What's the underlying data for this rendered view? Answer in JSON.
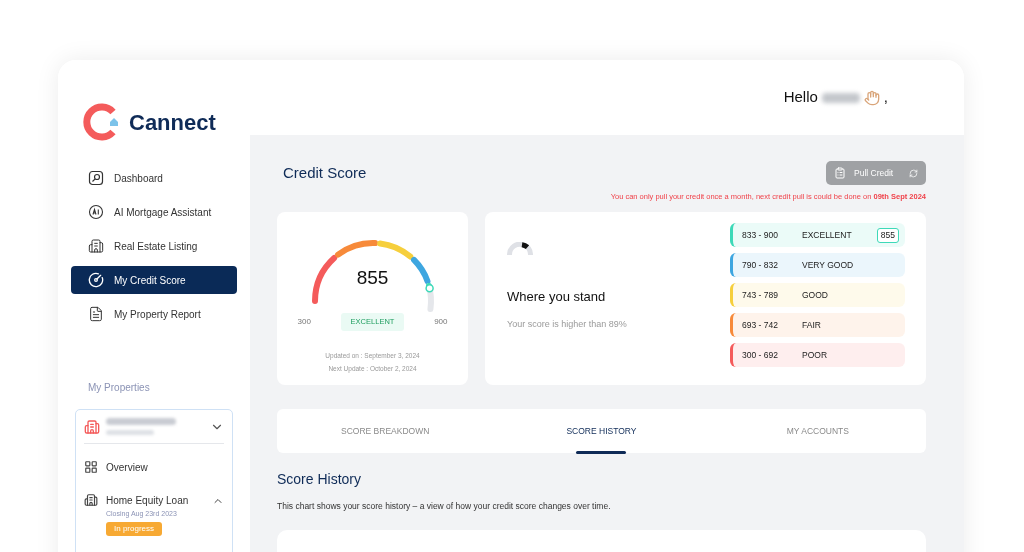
{
  "brand": {
    "name": "Cannect"
  },
  "sidebar": {
    "items": [
      {
        "label": "Dashboard",
        "selected": false
      },
      {
        "label": "AI Mortgage Assistant",
        "selected": false
      },
      {
        "label": "Real Estate Listing",
        "selected": false
      },
      {
        "label": "My Credit Score",
        "selected": true
      },
      {
        "label": "My Property Report",
        "selected": false
      }
    ],
    "section_title": "My Properties",
    "property": {
      "expanded": true,
      "items": [
        {
          "label": "Overview"
        },
        {
          "label": "Home Equity Loan",
          "expanded": true,
          "subtitle": "Closing Aug 23rd 2023",
          "status": "In progress"
        }
      ]
    }
  },
  "header": {
    "greeting": "Hello",
    "suffix": ","
  },
  "page": {
    "title": "Credit Score",
    "pull_button": {
      "label": "Pull Credit",
      "disabled": true
    },
    "notice": "You can only pull your credit once a month, next credit pull is could be done on **09th Sept 2024**"
  },
  "gauge": {
    "score": "855",
    "level": 0.93,
    "min": "300",
    "max": "900",
    "rating": "EXCELLENT",
    "updated": "Updated on : September 3, 2024",
    "next_update": "Next Update : October 2, 2024"
  },
  "standing": {
    "title": "Where you stand",
    "subtitle": "Your score is higher than 89%"
  },
  "ranges": [
    {
      "range": "833 - 900",
      "label": "EXCELLENT",
      "color": "#3dd9b8",
      "badge": "855"
    },
    {
      "range": "790 - 832",
      "label": "VERY GOOD",
      "color": "#3ea6e0"
    },
    {
      "range": "743 - 789",
      "label": "GOOD",
      "color": "#f6cf3c"
    },
    {
      "range": "693 - 742",
      "label": "FAIR",
      "color": "#f78a3a"
    },
    {
      "range": "300 - 692",
      "label": "POOR",
      "color": "#f45b5b"
    }
  ],
  "tabs": [
    {
      "label": "SCORE BREAKDOWN",
      "selected": false
    },
    {
      "label": "SCORE HISTORY",
      "selected": true
    },
    {
      "label": "MY ACCOUNTS",
      "selected": false
    }
  ],
  "history": {
    "title": "Score History",
    "description": "This chart shows your score history – a view of how your credit score changes over time."
  }
}
